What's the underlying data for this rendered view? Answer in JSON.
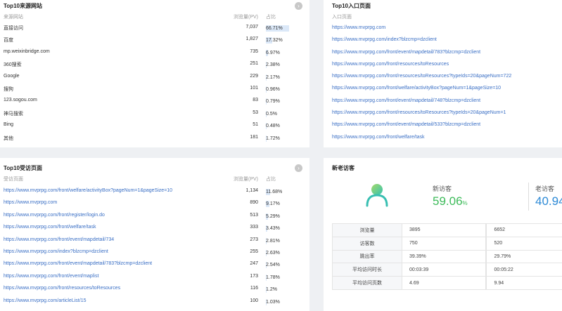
{
  "source_panel": {
    "title": "Top10来源网站",
    "col_name": "来源网站",
    "col_pv": "浏览量(PV)",
    "col_pct": "占比",
    "more_icon": "›",
    "rows": [
      {
        "name": "直接访问",
        "pv": "7,037",
        "pct": "66.71%",
        "share": 66.71
      },
      {
        "name": "百度",
        "pv": "1,827",
        "pct": "17.32%",
        "share": 17.32
      },
      {
        "name": "mp.weixinbridge.com",
        "pv": "735",
        "pct": "6.97%",
        "share": 6.97
      },
      {
        "name": "360搜索",
        "pv": "251",
        "pct": "2.38%",
        "share": 2.38
      },
      {
        "name": "Google",
        "pv": "229",
        "pct": "2.17%",
        "share": 2.17
      },
      {
        "name": "搜狗",
        "pv": "101",
        "pct": "0.96%",
        "share": 0.96
      },
      {
        "name": "123.sogou.com",
        "pv": "83",
        "pct": "0.79%",
        "share": 0.79
      },
      {
        "name": "神马搜索",
        "pv": "53",
        "pct": "0.5%",
        "share": 0.5
      },
      {
        "name": "Bing",
        "pv": "51",
        "pct": "0.48%",
        "share": 0.48
      },
      {
        "name": "其他",
        "pv": "181",
        "pct": "1.72%",
        "share": 1.72
      }
    ]
  },
  "entry_panel": {
    "title": "Top10入口页面",
    "col_name": "入口页面",
    "items": [
      "https://www.mvprpg.com",
      "https://www.mvprpg.com/index?blzcmp=dzclient",
      "https://www.mvprpg.com/front/event/mapdetail/783?blzcmp=dzclient",
      "https://www.mvprpg.com/front/resources/toResources",
      "https://www.mvprpg.com/front/resources/toResources?typeIds=20&pageNum=722",
      "https://www.mvprpg.com/front/welfare/activityBox?pageNum=1&pageSize=10",
      "https://www.mvprpg.com/front/event/mapdetail/748?blzcmp=dzclient",
      "https://www.mvprpg.com/front/resources/toResources?typeIds=20&pageNum=1",
      "https://www.mvprpg.com/front/event/mapdetail/533?blzcmp=dzclient",
      "https://www.mvprpg.com/front/welfare/task"
    ]
  },
  "visited_panel": {
    "title": "Top10受访页面",
    "col_name": "受访页面",
    "col_pv": "浏览量(PV)",
    "col_pct": "占比",
    "more_icon": "›",
    "rows": [
      {
        "name": "https://www.mvprpg.com/front/welfare/activityBox?pageNum=1&pageSize=10",
        "pv": "1,134",
        "pct": "11.68%",
        "share": 11.68
      },
      {
        "name": "https://www.mvprpg.com",
        "pv": "890",
        "pct": "9.17%",
        "share": 9.17
      },
      {
        "name": "https://www.mvprpg.com/front/register/login.do",
        "pv": "513",
        "pct": "5.29%",
        "share": 5.29
      },
      {
        "name": "https://www.mvprpg.com/front/welfare/task",
        "pv": "333",
        "pct": "3.43%",
        "share": 3.43
      },
      {
        "name": "https://www.mvprpg.com/front/event/mapdetail/734",
        "pv": "273",
        "pct": "2.81%",
        "share": 2.81
      },
      {
        "name": "https://www.mvprpg.com/index?blzcmp=dzclient",
        "pv": "255",
        "pct": "2.63%",
        "share": 2.63
      },
      {
        "name": "https://www.mvprpg.com/front/event/mapdetail/783?blzcmp=dzclient",
        "pv": "247",
        "pct": "2.54%",
        "share": 2.54
      },
      {
        "name": "https://www.mvprpg.com/front/event/maplist",
        "pv": "173",
        "pct": "1.78%",
        "share": 1.78
      },
      {
        "name": "https://www.mvprpg.com/front/resources/toResources",
        "pv": "116",
        "pct": "1.2%",
        "share": 1.2
      },
      {
        "name": "https://www.mvprpg.com/articleList/15",
        "pv": "100",
        "pct": "1.03%",
        "share": 1.03
      }
    ]
  },
  "visitor_panel": {
    "title": "新老访客",
    "new_label": "新访客",
    "new_value": "59.06",
    "new_unit": "%",
    "old_label": "老访客",
    "old_value": "40.94",
    "new_color": "#3dbb5a",
    "old_color": "#2d8ad6",
    "stats": [
      {
        "label": "浏览量",
        "new": "3895",
        "old": "6652"
      },
      {
        "label": "访客数",
        "new": "750",
        "old": "520"
      },
      {
        "label": "跳出率",
        "new": "39.39%",
        "old": "29.79%"
      },
      {
        "label": "平均访问时长",
        "new": "00:03:39",
        "old": "00:05:22"
      },
      {
        "label": "平均访问页数",
        "new": "4.69",
        "old": "9.94"
      }
    ]
  }
}
